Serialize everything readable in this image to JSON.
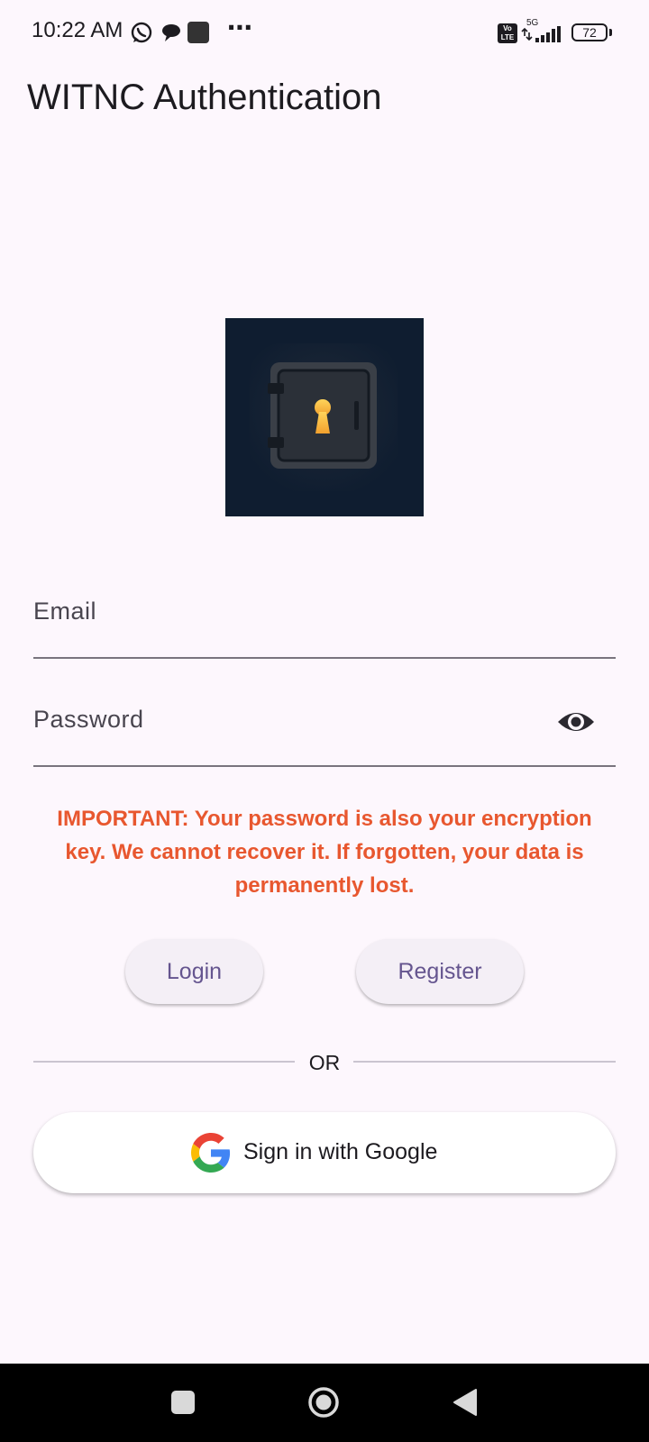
{
  "status_bar": {
    "time": "10:22 AM",
    "volte": "Vo LTE",
    "network": "5G",
    "battery": "72",
    "icons": [
      "whatsapp-icon",
      "chat-bubble-icon",
      "app-square-icon",
      "more-dots-icon",
      "volte-icon",
      "signal-icon",
      "battery-icon"
    ]
  },
  "app_bar": {
    "title": "WITNC Authentication"
  },
  "form": {
    "email_label": "Email",
    "password_label": "Password",
    "password_toggle_icon": "eye-icon"
  },
  "warning": "IMPORTANT: Your password is also your encryption key. We cannot recover it. If forgotten, your data is permanently lost.",
  "buttons": {
    "login": "Login",
    "register": "Register",
    "or": "OR",
    "google": "Sign in with Google"
  },
  "colors": {
    "background": "#fdf7fd",
    "warning": "#e8572f",
    "button_text": "#65558f",
    "logo_bg": "#0f1d30",
    "keyhole": "#f6b438"
  }
}
